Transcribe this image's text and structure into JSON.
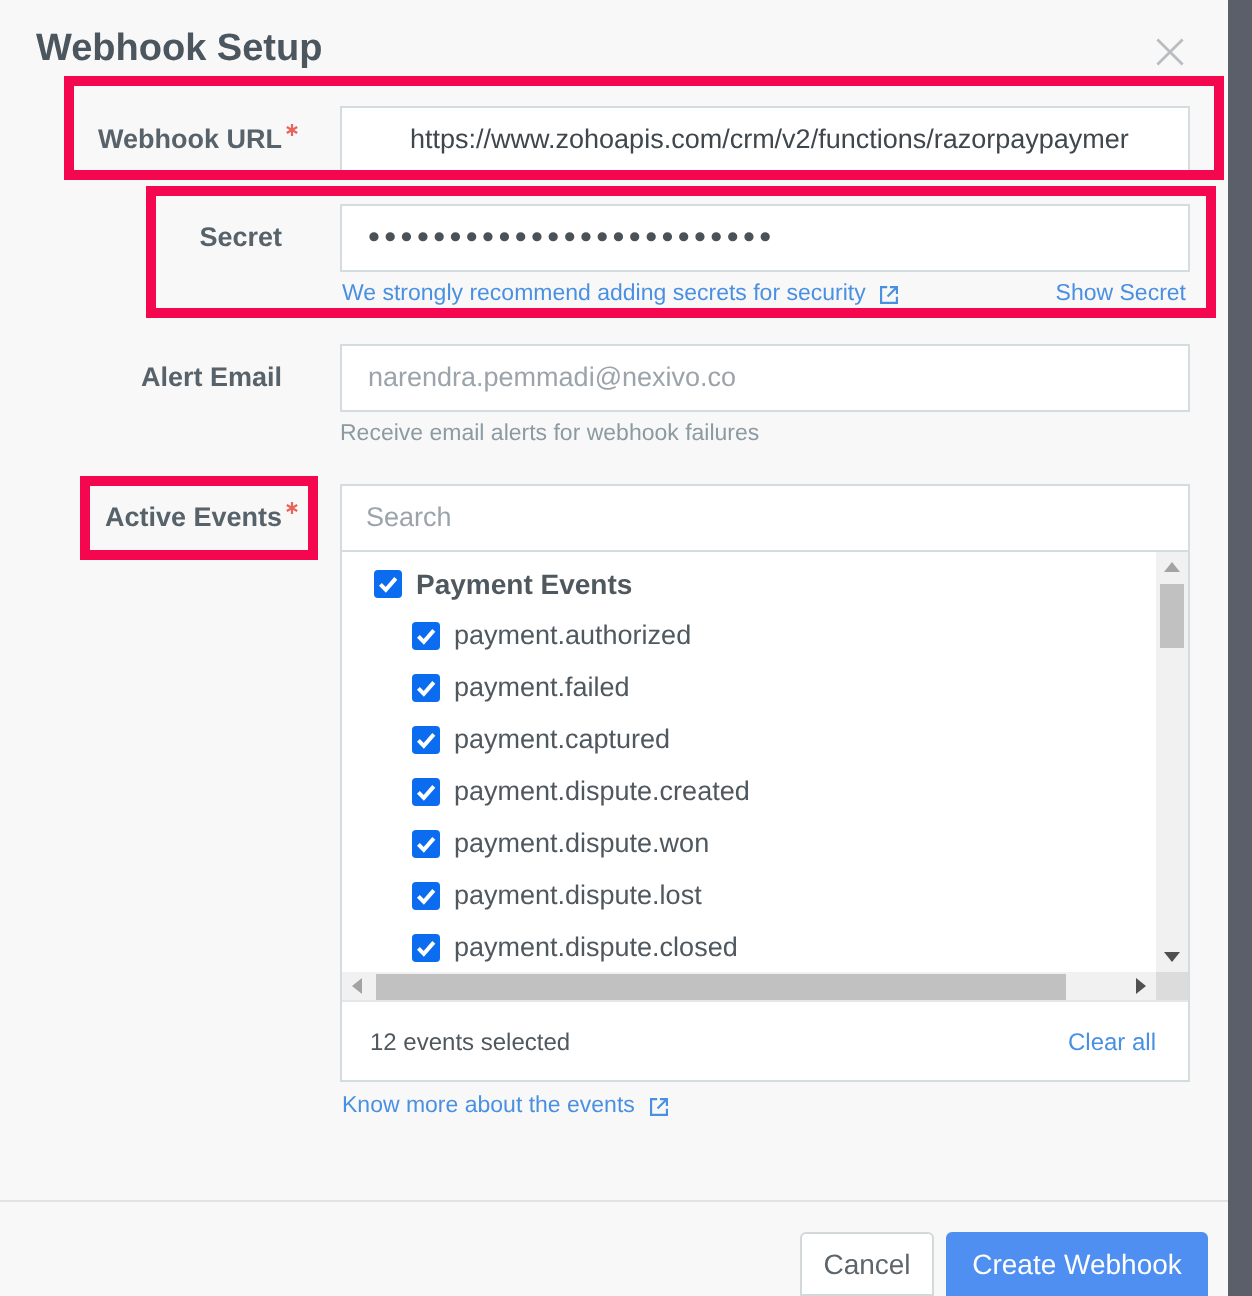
{
  "dialog": {
    "title": "Webhook Setup"
  },
  "fields": [
    {
      "kind": "url",
      "label": "Webhook URL",
      "required": true,
      "highlighted": true,
      "value": "https://www.zohoapis.com/crm/v2/functions/razorpaypaymer"
    },
    {
      "kind": "secret",
      "label": "Secret",
      "required": false,
      "highlighted": true,
      "value": "•••••••••••••••••••••••••",
      "help_link": "We strongly recommend adding secrets for security",
      "toggle_link": "Show Secret"
    },
    {
      "kind": "email",
      "label": "Alert Email",
      "required": false,
      "highlighted": false,
      "placeholder": "narendra.pemmadi@nexivo.co",
      "help": "Receive email alerts for webhook failures"
    },
    {
      "kind": "events",
      "label": "Active Events",
      "required": true,
      "highlighted": true,
      "placeholder": "Search",
      "groups": [
        {
          "label": "Payment Events",
          "checked": true,
          "children": [
            {
              "label": "payment.authorized",
              "checked": true
            },
            {
              "label": "payment.failed",
              "checked": true
            },
            {
              "label": "payment.captured",
              "checked": true
            },
            {
              "label": "payment.dispute.created",
              "checked": true
            },
            {
              "label": "payment.dispute.won",
              "checked": true
            },
            {
              "label": "payment.dispute.lost",
              "checked": true
            },
            {
              "label": "payment.dispute.closed",
              "checked": true
            }
          ]
        }
      ],
      "summary": "12 events selected",
      "clear_link": "Clear all",
      "help_link": "Know more about the events"
    }
  ],
  "buttons": [
    {
      "kind": "secondary",
      "label": "Cancel"
    },
    {
      "kind": "primary",
      "label": "Create Webhook"
    }
  ]
}
